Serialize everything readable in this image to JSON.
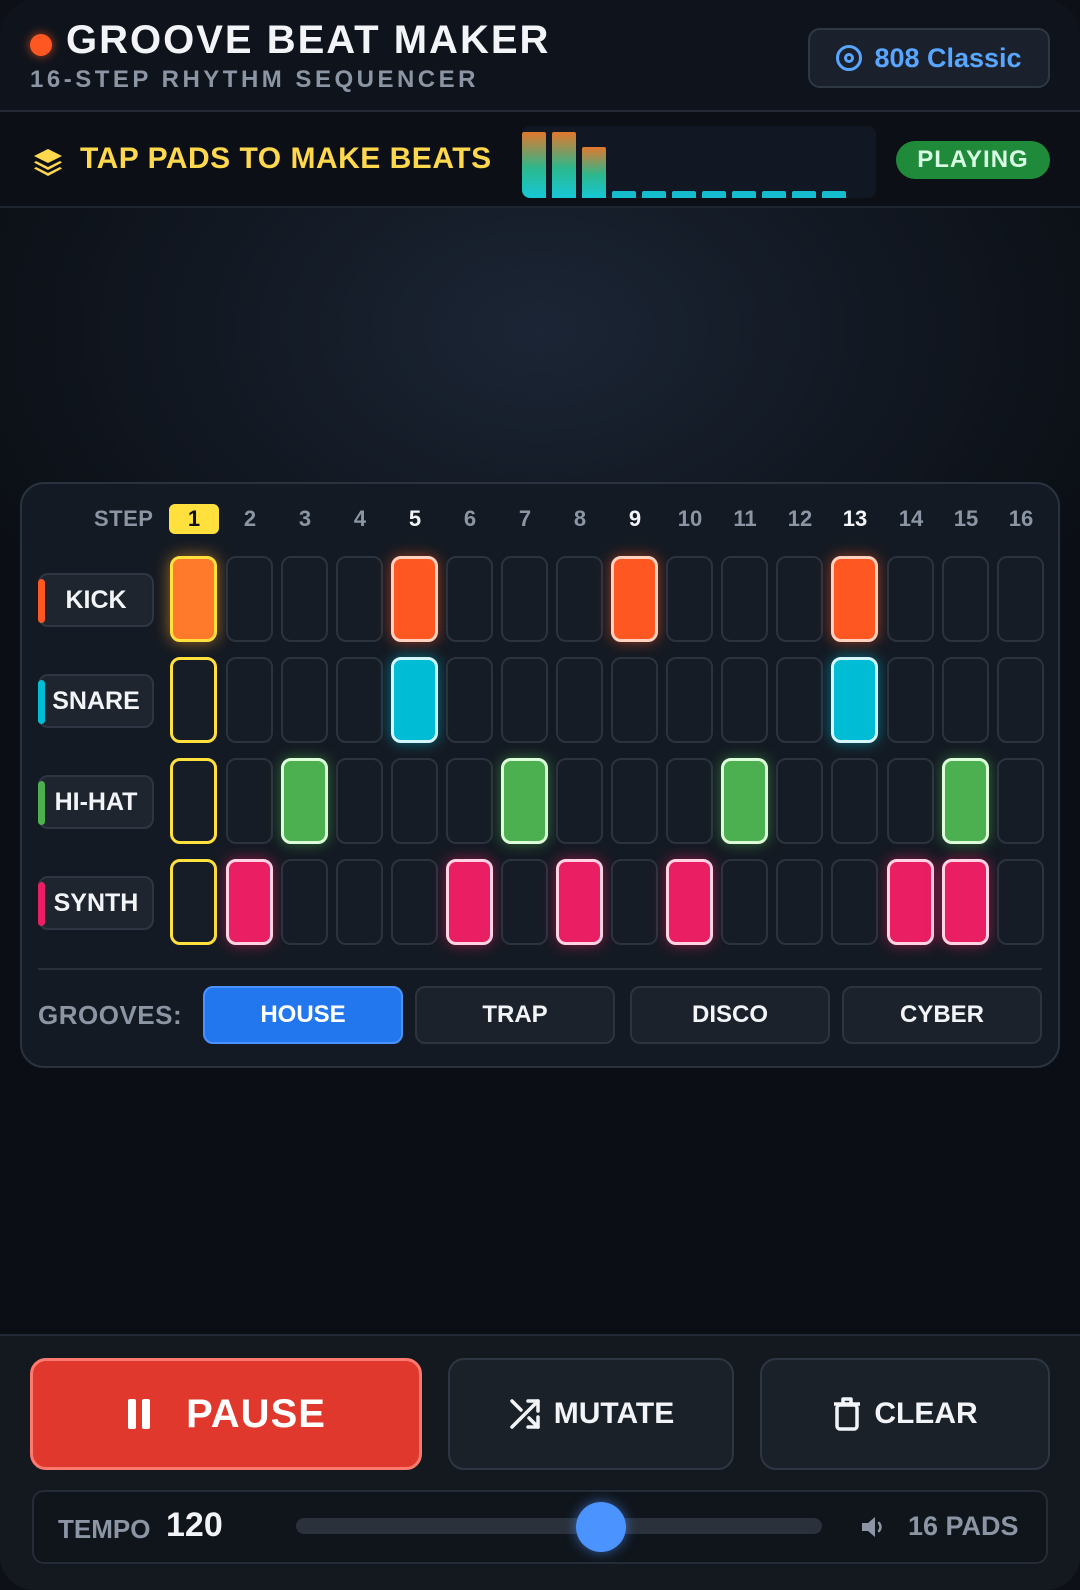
{
  "header": {
    "title": "GROOVE BEAT MAKER",
    "subtitle": "16-STEP RHYTHM SEQUENCER",
    "kit_label": "808 Classic",
    "kit_icon": "target-icon",
    "indicator_color": "#ff5722"
  },
  "infobar": {
    "hint": "TAP PADS TO MAKE BEATS",
    "hint_icon": "layers-icon",
    "status": "PLAYING",
    "meter_levels": [
      1.0,
      1.0,
      0.78,
      0.1,
      0.1,
      0.1,
      0.1,
      0.1,
      0.1,
      0.1,
      0.1
    ]
  },
  "sequencer": {
    "step_label": "STEP",
    "steps": [
      "1",
      "2",
      "3",
      "4",
      "5",
      "6",
      "7",
      "8",
      "9",
      "10",
      "11",
      "12",
      "13",
      "14",
      "15",
      "16"
    ],
    "current_step": 1,
    "accent_steps": [
      5,
      9,
      13
    ],
    "tracks": [
      {
        "name": "KICK",
        "key": "kick",
        "color": "#ff5722",
        "pattern": [
          1,
          0,
          0,
          0,
          1,
          0,
          0,
          0,
          1,
          0,
          0,
          0,
          1,
          0,
          0,
          0
        ]
      },
      {
        "name": "SNARE",
        "key": "snare",
        "color": "#00bcd4",
        "pattern": [
          0,
          0,
          0,
          0,
          1,
          0,
          0,
          0,
          0,
          0,
          0,
          0,
          1,
          0,
          0,
          0
        ]
      },
      {
        "name": "HI-HAT",
        "key": "hihat",
        "color": "#4caf50",
        "pattern": [
          0,
          0,
          1,
          0,
          0,
          0,
          1,
          0,
          0,
          0,
          1,
          0,
          0,
          0,
          1,
          0
        ]
      },
      {
        "name": "SYNTH",
        "key": "synth",
        "color": "#e91e63",
        "pattern": [
          0,
          1,
          0,
          0,
          0,
          1,
          0,
          1,
          0,
          1,
          0,
          0,
          0,
          1,
          1,
          0
        ]
      }
    ]
  },
  "grooves": {
    "label": "GROOVES:",
    "options": [
      "HOUSE",
      "TRAP",
      "DISCO",
      "CYBER"
    ],
    "selected": "HOUSE"
  },
  "controls": {
    "pause_label": "PAUSE",
    "mutate_label": "MUTATE",
    "clear_label": "CLEAR",
    "pause_color": "#e0382c"
  },
  "tempo": {
    "label": "TEMPO",
    "value": "120",
    "slider_fraction": 0.58,
    "pads_label": "16 PADS"
  },
  "colors": {
    "accent_blue": "#2277ee",
    "current_step": "#ffe03d",
    "status_green": "#1f8a3a"
  }
}
